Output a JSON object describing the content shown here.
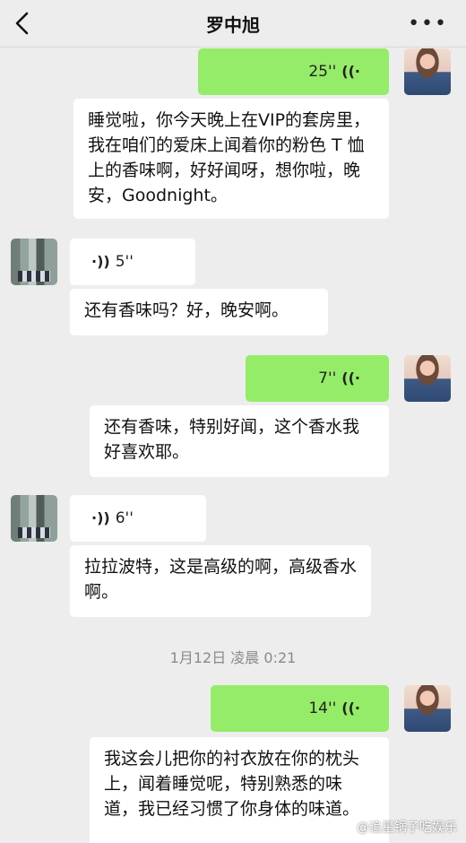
{
  "header": {
    "title": "罗中旭",
    "more": "•••"
  },
  "messages": [
    {
      "type": "voice",
      "side": "right",
      "duration": "25''"
    },
    {
      "type": "text",
      "side": "right",
      "text": "睡觉啦，你今天晚上在VIP的套房里，我在咱们的爱床上闻着你的粉色 T 恤上的香味啊，好好闻呀，想你啦，晚安，Goodnight。"
    },
    {
      "type": "voice",
      "side": "left",
      "duration": "5''"
    },
    {
      "type": "text",
      "side": "left",
      "text": "还有香味吗？好，晚安啊。"
    },
    {
      "type": "voice",
      "side": "right",
      "duration": "7''"
    },
    {
      "type": "text",
      "side": "right",
      "text": "还有香味，特别好闻，这个香水我好喜欢耶。"
    },
    {
      "type": "voice",
      "side": "left",
      "duration": "6''"
    },
    {
      "type": "text",
      "side": "left",
      "text": "拉拉波特，这是高级的啊，高级香水啊。"
    },
    {
      "type": "voice",
      "side": "right",
      "duration": "14''"
    },
    {
      "type": "text",
      "side": "right",
      "text": "我这会儿把你的衬衣放在你的枕头上，闻着睡觉呢，特别熟悉的味道，我已经习惯了你身体的味道。"
    }
  ],
  "timestamp": "1月12日 凌晨 0:21",
  "watermark": "@追星锅子吃娱乐"
}
